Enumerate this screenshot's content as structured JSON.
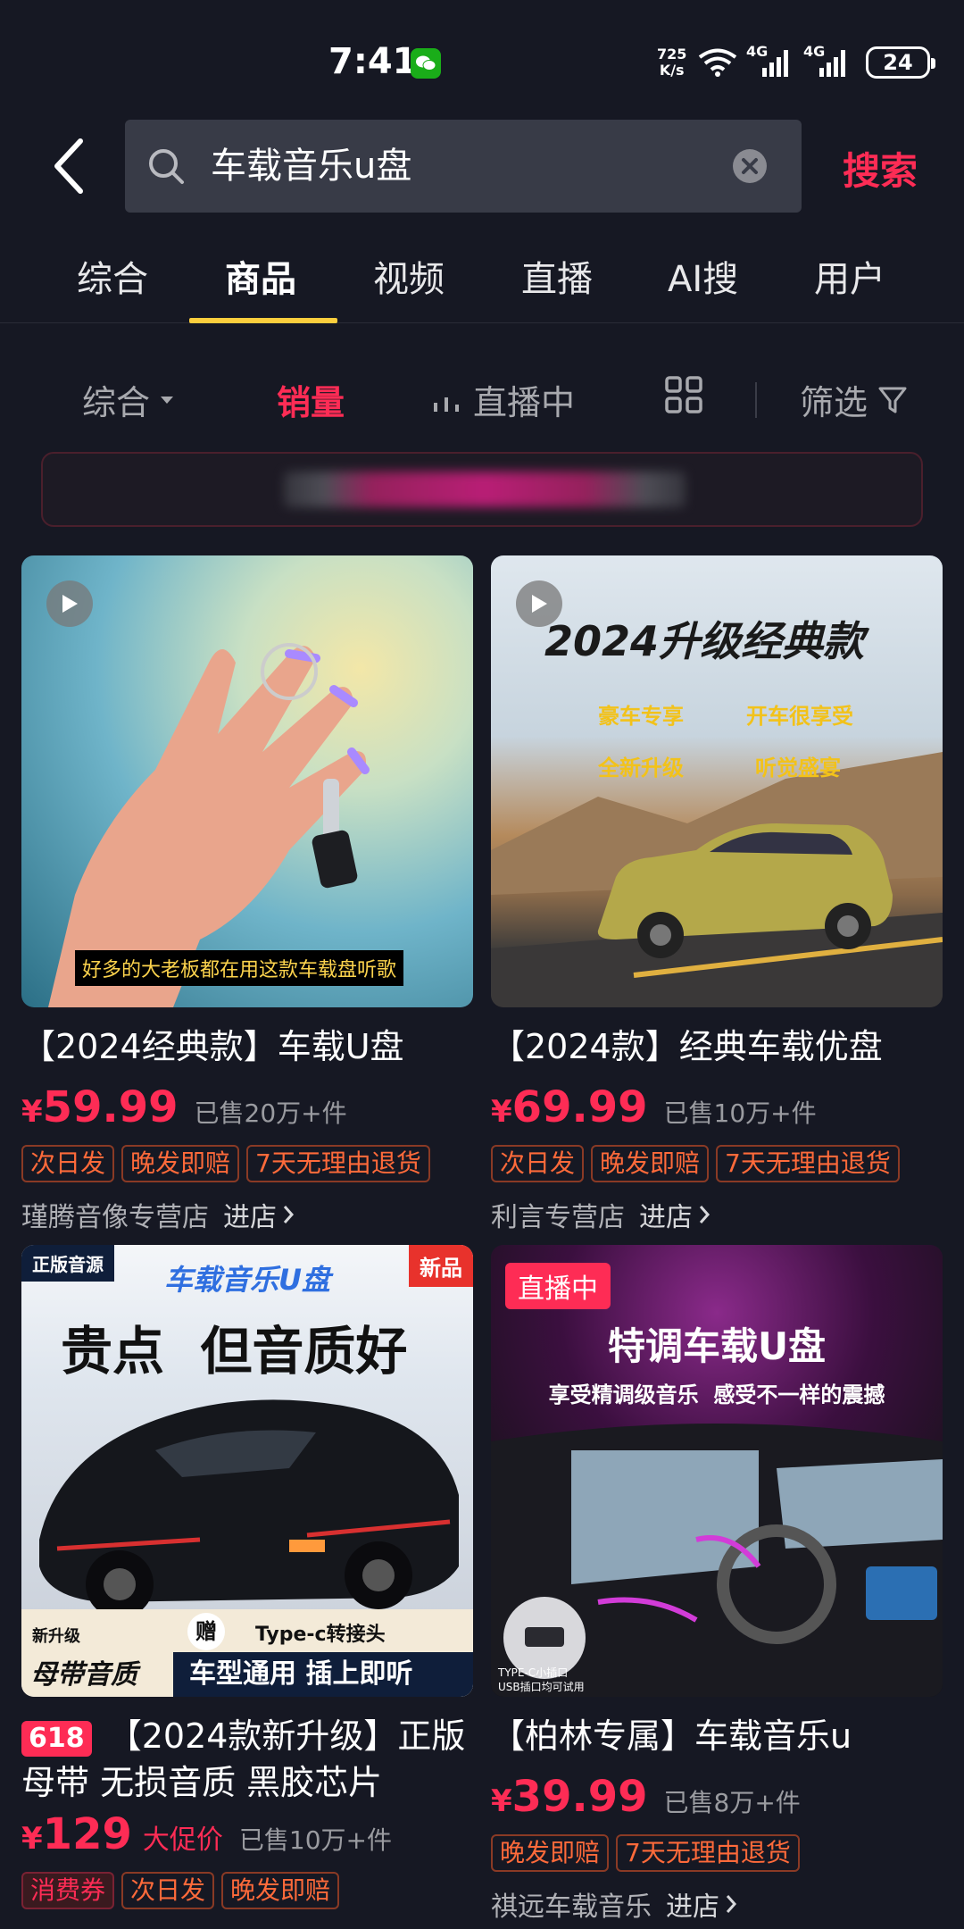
{
  "status": {
    "time": "7:41",
    "net_speed_top": "725",
    "net_speed_bottom": "K/s",
    "signal1": "4G",
    "signal2": "4G",
    "battery": "24"
  },
  "search": {
    "query": "车载音乐u盘",
    "submit_label": "搜索"
  },
  "tabs": [
    {
      "label": "综合"
    },
    {
      "label": "商品"
    },
    {
      "label": "视频"
    },
    {
      "label": "直播"
    },
    {
      "label": "AI搜"
    },
    {
      "label": "用户"
    }
  ],
  "filters": {
    "sort_default": "综合",
    "sales": "销量",
    "live": "直播中",
    "filter": "筛选"
  },
  "products": [
    {
      "title": "【2024经典款】车载U盘",
      "price": "59.99",
      "sold": "已售20万+件",
      "tags": [
        "次日发",
        "晚发即赔",
        "7天无理由退货"
      ],
      "shop": "瑾腾音像专营店",
      "enter": "进店",
      "image_caption": "好多的大老板都在用这款车载盘听歌"
    },
    {
      "title": "【2024款】经典车载优盘",
      "price": "69.99",
      "sold": "已售10万+件",
      "tags": [
        "次日发",
        "晚发即赔",
        "7天无理由退货"
      ],
      "shop": "利言专营店",
      "enter": "进店",
      "image_heading": "2024升级经典款",
      "image_points": [
        "豪车专享",
        "开车很享受",
        "全新升级",
        "听觉盛宴"
      ]
    },
    {
      "badge": "618",
      "title": "【2024款新升级】正版母带 无损音质 黑胶芯片",
      "price": "129",
      "promo": "大促价",
      "sold": "已售10万+件",
      "tags": [
        "消费券",
        "次日发",
        "晚发即赔"
      ],
      "image_corner": "正版音源",
      "image_new": "新品",
      "image_heading": "车载音乐U盘",
      "image_slogan": "贵点  但音质好",
      "image_footer_left_small": "新升级",
      "image_footer_left_big": "母带音质",
      "image_gift": "赠",
      "image_gift_text": "Type-c转接头",
      "image_footer_right": "车型通用 插上即听"
    },
    {
      "title": "【柏林专属】车载音乐u",
      "price": "39.99",
      "sold": "已售8万+件",
      "tags": [
        "晚发即赔",
        "7天无理由退货"
      ],
      "shop": "祺远车载音乐",
      "enter": "进店",
      "image_live": "直播中",
      "image_heading": "特调车载U盘",
      "image_sub": "享受精调级音乐  感受不一样的震撼",
      "image_usb1": "TYPE-C小插口",
      "image_usb2": "USB插口均可试用"
    }
  ],
  "colors": {
    "background": "#161823",
    "accent_red": "#fe2c55",
    "tab_underline": "#fcce3d"
  }
}
